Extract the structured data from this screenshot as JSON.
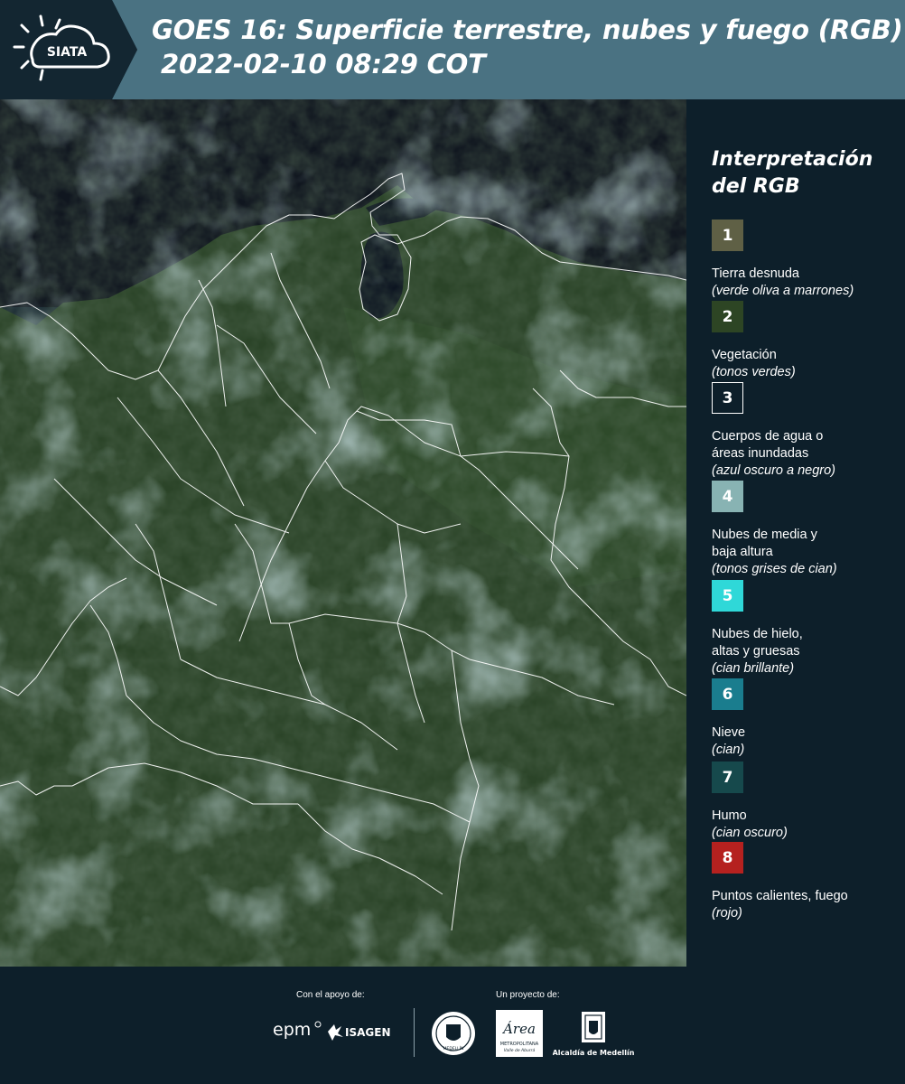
{
  "header": {
    "logo_text": "SIATA",
    "title_line1": "GOES 16: Superficie terrestre, nubes y fuego (RGB)",
    "title_line2": "2022-02-10 08:29 COT",
    "colors": {
      "panel": "#132631",
      "band": "#4a7282"
    }
  },
  "map": {
    "description_icon": "satellite-rgb-map",
    "colors": {
      "vegetation": "#2e4a2c",
      "cloud": "#8fb4ba",
      "water": "#0f1724",
      "border": "#ffffff"
    }
  },
  "legend": {
    "title_line1": "Interpretación",
    "title_line2": "del RGB",
    "items": [
      {
        "number": "1",
        "label": "Tierra desnuda",
        "note": "(verde oliva a marrones)",
        "color": "#5f6045",
        "outlined": false
      },
      {
        "number": "2",
        "label": "Vegetación",
        "note": "(tonos verdes)",
        "color": "#2d4524",
        "outlined": false
      },
      {
        "number": "3",
        "label": "Cuerpos de agua o\náreas inundadas",
        "note": "(azul oscuro a negro)",
        "color": "#0d1f2a",
        "outlined": true
      },
      {
        "number": "4",
        "label": "Nubes de media y\nbaja altura",
        "note": "(tonos grises de cian)",
        "color": "#88b3b3",
        "outlined": false
      },
      {
        "number": "5",
        "label": "Nubes de hielo,\naltas y gruesas",
        "note": "(cian brillante)",
        "color": "#2fd8d8",
        "outlined": false
      },
      {
        "number": "6",
        "label": "Nieve",
        "note": "(cian)",
        "color": "#1a7d8e",
        "outlined": false
      },
      {
        "number": "7",
        "label": "Humo",
        "note": "(cian oscuro)",
        "color": "#16494c",
        "outlined": false
      },
      {
        "number": "8",
        "label": "Puntos calientes, fuego",
        "note": "(rojo)",
        "color": "#b5211f",
        "outlined": false
      }
    ]
  },
  "footer": {
    "support_label": "Con el apoyo de:",
    "project_label": "Un proyecto de:",
    "sponsors": {
      "epm": "epm",
      "isagen": "ISAGEN",
      "metro_title": "Área",
      "metro_sub": "METROPOLITANA",
      "metro_sub2": "Valle de Aburrá",
      "alcaldia": "Alcaldía de Medellín",
      "seal_text": "MEDELLÍN"
    }
  }
}
